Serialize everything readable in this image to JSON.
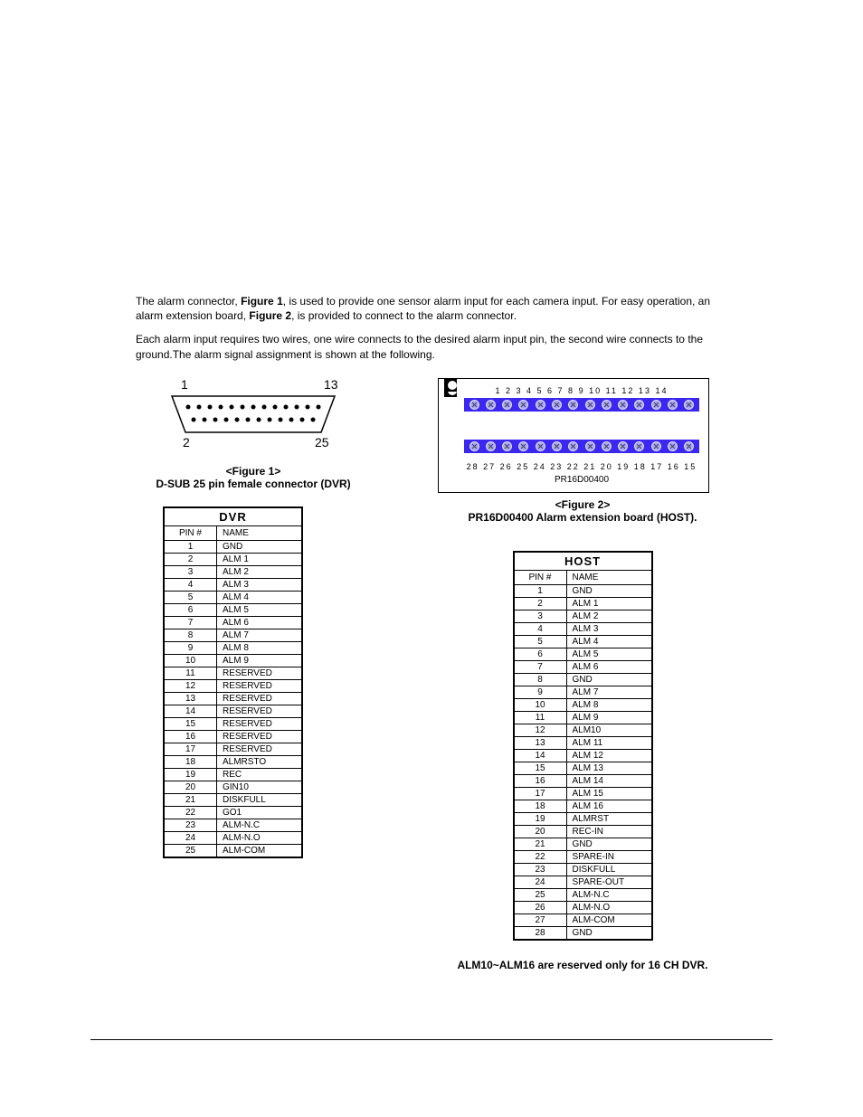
{
  "intro": {
    "p1a": "The alarm connector, ",
    "p1b": "Figure 1",
    "p1c": ", is used to provide one sensor alarm input for each camera input. For easy operation, an alarm extension board, ",
    "p1d": "Figure 2",
    "p1e": ", is provided to connect to the alarm connector.",
    "p2": "Each alarm input requires two wires, one wire connects to the desired alarm input pin, the second wire connects to the ground.The alarm signal assignment is shown at the following."
  },
  "fig1": {
    "num1": "1",
    "num13": "13",
    "num2": "2",
    "num25": "25",
    "capLabel": "<Figure 1>",
    "capText": "D-SUB 25 pin female connector (DVR)"
  },
  "fig2": {
    "topNums": "1  2  3  4  5  6  7  8  9  10 11 12 13 14",
    "botNums": "28 27 26 25 24 23 22 21 20 19 18 17 16 15",
    "partNum": "PR16D00400",
    "capLabel": "<Figure 2>",
    "capText": "PR16D00400 Alarm extension board (HOST)."
  },
  "dvrTable": {
    "title": "DVR",
    "colPin": "PIN #",
    "colName": "NAME",
    "rows": [
      {
        "pin": "1",
        "name": "GND"
      },
      {
        "pin": "2",
        "name": "ALM 1"
      },
      {
        "pin": "3",
        "name": "ALM 2"
      },
      {
        "pin": "4",
        "name": "ALM 3"
      },
      {
        "pin": "5",
        "name": "ALM 4"
      },
      {
        "pin": "6",
        "name": "ALM 5"
      },
      {
        "pin": "7",
        "name": "ALM 6"
      },
      {
        "pin": "8",
        "name": "ALM 7"
      },
      {
        "pin": "9",
        "name": "ALM 8"
      },
      {
        "pin": "10",
        "name": "ALM 9"
      },
      {
        "pin": "11",
        "name": "RESERVED"
      },
      {
        "pin": "12",
        "name": "RESERVED"
      },
      {
        "pin": "13",
        "name": "RESERVED"
      },
      {
        "pin": "14",
        "name": "RESERVED"
      },
      {
        "pin": "15",
        "name": "RESERVED"
      },
      {
        "pin": "16",
        "name": "RESERVED"
      },
      {
        "pin": "17",
        "name": "RESERVED"
      },
      {
        "pin": "18",
        "name": "ALMRSTO"
      },
      {
        "pin": "19",
        "name": "REC"
      },
      {
        "pin": "20",
        "name": "GIN10"
      },
      {
        "pin": "21",
        "name": "DISKFULL"
      },
      {
        "pin": "22",
        "name": "GO1"
      },
      {
        "pin": "23",
        "name": "ALM-N.C"
      },
      {
        "pin": "24",
        "name": "ALM-N.O"
      },
      {
        "pin": "25",
        "name": "ALM-COM"
      }
    ]
  },
  "hostTable": {
    "title": "HOST",
    "colPin": "PIN #",
    "colName": "NAME",
    "rows": [
      {
        "pin": "1",
        "name": "GND"
      },
      {
        "pin": "2",
        "name": "ALM 1"
      },
      {
        "pin": "3",
        "name": "ALM 2"
      },
      {
        "pin": "4",
        "name": "ALM 3"
      },
      {
        "pin": "5",
        "name": "ALM 4"
      },
      {
        "pin": "6",
        "name": "ALM 5"
      },
      {
        "pin": "7",
        "name": "ALM 6"
      },
      {
        "pin": "8",
        "name": "GND"
      },
      {
        "pin": "9",
        "name": "ALM 7"
      },
      {
        "pin": "10",
        "name": "ALM 8"
      },
      {
        "pin": "11",
        "name": "ALM 9"
      },
      {
        "pin": "12",
        "name": "ALM10"
      },
      {
        "pin": "13",
        "name": "ALM 11"
      },
      {
        "pin": "14",
        "name": "ALM 12"
      },
      {
        "pin": "15",
        "name": "ALM 13"
      },
      {
        "pin": "16",
        "name": "ALM 14"
      },
      {
        "pin": "17",
        "name": "ALM 15"
      },
      {
        "pin": "18",
        "name": "ALM 16"
      },
      {
        "pin": "19",
        "name": "ALMRST"
      },
      {
        "pin": "20",
        "name": "REC-IN"
      },
      {
        "pin": "21",
        "name": "GND"
      },
      {
        "pin": "22",
        "name": "SPARE-IN"
      },
      {
        "pin": "23",
        "name": "DISKFULL"
      },
      {
        "pin": "24",
        "name": "SPARE-OUT"
      },
      {
        "pin": "25",
        "name": "ALM-N.C"
      },
      {
        "pin": "26",
        "name": "ALM-N.O"
      },
      {
        "pin": "27",
        "name": "ALM-COM"
      },
      {
        "pin": "28",
        "name": "GND"
      }
    ]
  },
  "note": "ALM10~ALM16 are reserved only for 16 CH DVR."
}
